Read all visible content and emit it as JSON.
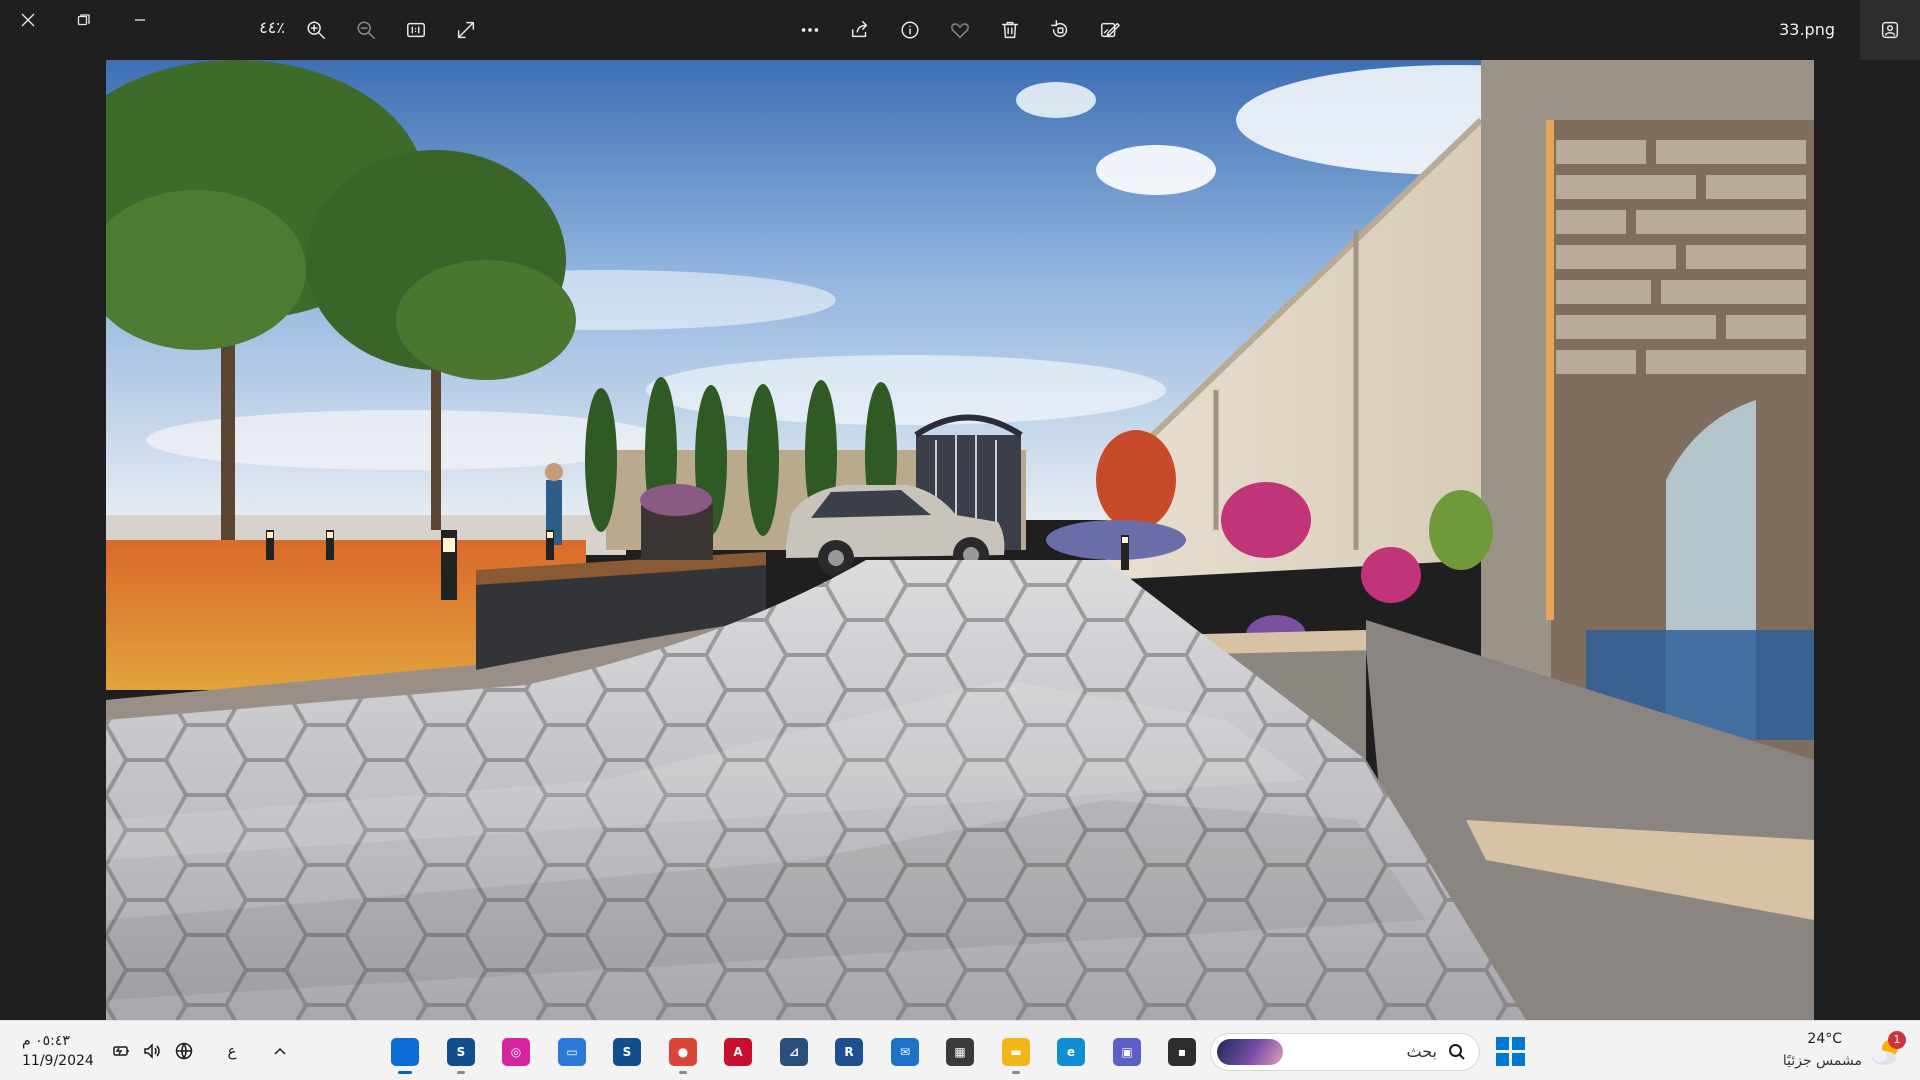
{
  "window": {
    "title": "33.png",
    "zoom_level": "٤٤٪"
  },
  "toolbar": {
    "left_icons": [
      "close-icon",
      "restore-icon",
      "minimize-icon"
    ],
    "view_icons": [
      "zoom-in-icon",
      "zoom-out-icon",
      "actual-size-icon",
      "fit-expand-icon"
    ],
    "action_icons": [
      "more-icon",
      "share-icon",
      "info-icon",
      "favorite-icon",
      "delete-icon",
      "rotate-icon",
      "edit-icon"
    ],
    "slideshow_icon": "slideshow-icon"
  },
  "taskbar": {
    "clock_time": "٠٥:٤٣ م",
    "clock_date": "11/9/2024",
    "language": "ع",
    "search_placeholder": "بحث",
    "weather_temp": "24°C",
    "weather_condition": "مشمس جزئيًا",
    "notification_count": "1",
    "apps": [
      {
        "name": "photos",
        "glyph": "",
        "color": "#0a6cd6",
        "active": true
      },
      {
        "name": "sketchup",
        "glyph": "S",
        "color": "#134f8c",
        "active": false
      },
      {
        "name": "instagram",
        "glyph": "◎",
        "color": "#d6249f",
        "active": false
      },
      {
        "name": "screen-app",
        "glyph": "▭",
        "color": "#2b79d8",
        "active": false
      },
      {
        "name": "sketchup-2",
        "glyph": "S",
        "color": "#134f8c",
        "active": false
      },
      {
        "name": "chrome",
        "glyph": "●",
        "color": "#db4437",
        "active": false
      },
      {
        "name": "autocad",
        "glyph": "A",
        "color": "#c8102e",
        "active": false
      },
      {
        "name": "edu",
        "glyph": "⊿",
        "color": "#2a4f7a",
        "active": false
      },
      {
        "name": "revit",
        "glyph": "R",
        "color": "#1d4f91",
        "active": false
      },
      {
        "name": "mail",
        "glyph": "✉",
        "color": "#1a73c6",
        "active": false
      },
      {
        "name": "store",
        "glyph": "▦",
        "color": "#3a3a3a",
        "active": false
      },
      {
        "name": "file-explorer",
        "glyph": "▬",
        "color": "#f2b619",
        "active": false
      },
      {
        "name": "edge",
        "glyph": "e",
        "color": "#0f8fd2",
        "active": false
      },
      {
        "name": "teams",
        "glyph": "▣",
        "color": "#5b5fc7",
        "active": false
      },
      {
        "name": "terminal",
        "glyph": "▪",
        "color": "#2d2d2d",
        "active": false
      }
    ]
  },
  "photo": {
    "description_icon": "landscape-render-image"
  }
}
